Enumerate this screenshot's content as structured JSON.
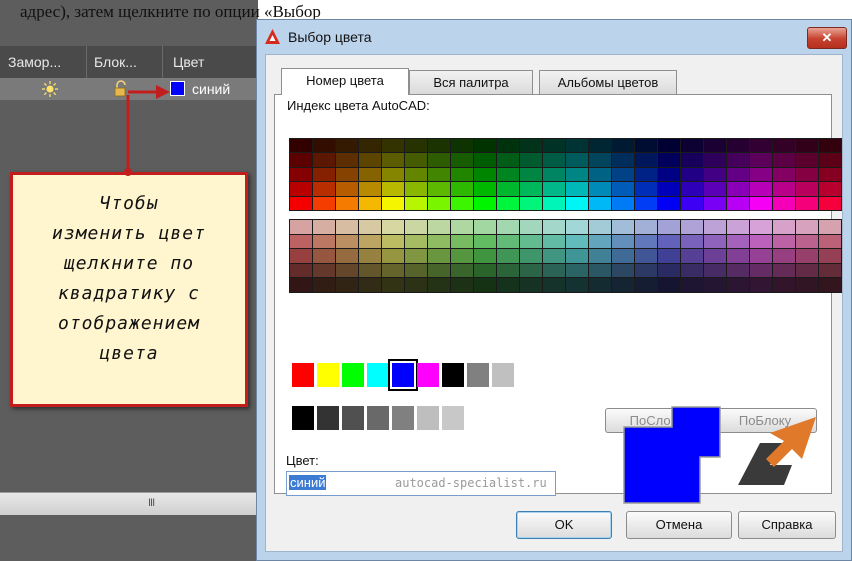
{
  "top_caption": "адрес), затем щелкните по опции «Выбор",
  "layer_panel": {
    "columns": [
      "Замор...",
      "Блок...",
      "Цвет"
    ],
    "row": {
      "color_name": "синий",
      "color_hex": "#0000ff"
    },
    "scrollbar_grip": "III"
  },
  "callout": {
    "text": "Чтобы\nизменить цвет\nщелкните по\nквадратику с\nотображением\nцвета",
    "border_color": "#c31e1e",
    "background": "#fff5cf"
  },
  "dialog": {
    "title": "Выбор цвета",
    "close_label": "✕",
    "tabs": [
      {
        "label": "Номер цвета",
        "active": true
      },
      {
        "label": "Вся палитра",
        "active": false
      },
      {
        "label": "Альбомы цветов",
        "active": false
      }
    ],
    "aci_label": "Индекс цвета AutoCAD:",
    "standard_colors": [
      "#ff0000",
      "#ffff00",
      "#00ff00",
      "#00ffff",
      "#0000ff",
      "#ff00ff",
      "#000000",
      "#808080",
      "#c0c0c0"
    ],
    "selected_standard_index": 4,
    "gray_colors": [
      "#000000",
      "#333333",
      "#505050",
      "#696969",
      "#808080",
      "#bebebe",
      "#c8c8c8"
    ],
    "bylayer_label": "ПоСлою",
    "byblock_label": "ПоБлоку",
    "color_label": "Цвет:",
    "color_value": "синий",
    "watermark": "autocad-specialist.ru",
    "preview_color": "#0000ff",
    "ok_label": "OK",
    "cancel_label": "Отмена",
    "help_label": "Справка"
  }
}
